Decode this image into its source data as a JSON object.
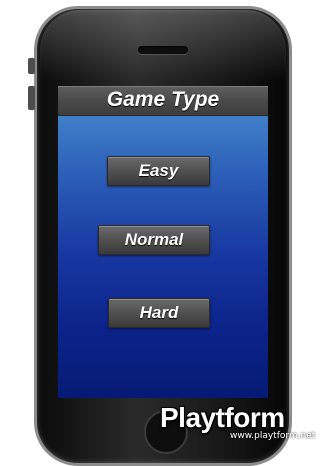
{
  "screen": {
    "title": "Game Type",
    "buttons": [
      {
        "label": "Easy"
      },
      {
        "label": "Normal"
      },
      {
        "label": "Hard"
      }
    ]
  },
  "watermark": {
    "brand": "Playtform",
    "url": "www.playtform.net"
  },
  "colors": {
    "screen_top": "#4b90d1",
    "screen_bottom": "#061a74",
    "button_face": "#505050",
    "title_bar": "#4a4a4a"
  }
}
